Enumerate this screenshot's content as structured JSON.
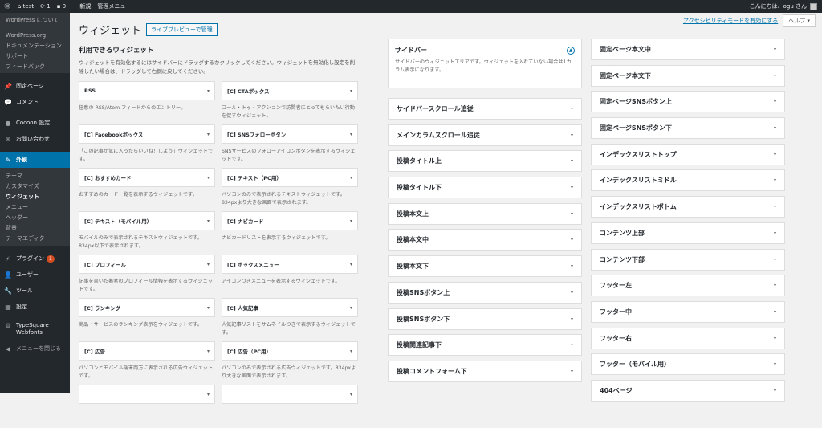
{
  "adminbar": {
    "site": "test",
    "updates": "1",
    "comments": "0",
    "new": "新規",
    "manage": "管理メニュー",
    "greeting": "こんにちは、ogu さん"
  },
  "menu": {
    "about": "WordPress について",
    "org": [
      "WordPress.org",
      "ドキュメンテーション",
      "サポート",
      "フィードバック"
    ],
    "items1": [
      {
        "icon": "📌",
        "label": "固定ページ"
      },
      {
        "icon": "💬",
        "label": "コメント"
      }
    ],
    "items2": [
      {
        "icon": "●",
        "label": "Cocoon 設定"
      },
      {
        "icon": "✉",
        "label": "お問い合わせ"
      }
    ],
    "appearance": "外観",
    "appearance_sub": [
      "テーマ",
      "カスタマイズ",
      "ウィジェット",
      "メニュー",
      "ヘッダー",
      "背景",
      "テーマエディター"
    ],
    "plugins": "プラグイン",
    "plugins_badge": "1",
    "users": "ユーザー",
    "tools": "ツール",
    "settings": "設定",
    "typesquare": "TypeSquare Webfonts",
    "collapse": "メニューを閉じる"
  },
  "screen": {
    "a11y": "アクセシビリティモードを有効にする",
    "help": "ヘルプ ▾"
  },
  "page": {
    "title": "ウィジェット",
    "live_preview": "ライブプレビューで管理"
  },
  "available": {
    "heading": "利用できるウィジェット",
    "desc": "ウィジェットを有効化するにはサイドバーにドラッグするかクリックしてください。ウィジェットを無効化し設定を削除したい場合は、ドラッグして右側に戻してください。",
    "widgets": [
      {
        "name": "RSS",
        "desc": "任意の RSS/Atom フィードからのエントリー。"
      },
      {
        "name": "[C] CTAボックス",
        "desc": "コール・トゥ・アクションで訪問者にとってもらいたい行動を促すウィジェット。"
      },
      {
        "name": "[C] Facebookボックス",
        "desc": "「この記事が気に入ったらいいね！しよう」ウィジェットです。"
      },
      {
        "name": "[C] SNSフォローボタン",
        "desc": "SNSサービスのフォローアイコンボタンを表示するウィジェットです。"
      },
      {
        "name": "[C] おすすめカード",
        "desc": "おすすめのカード一覧を表示するウィジェットです。"
      },
      {
        "name": "[C] テキスト（PC用）",
        "desc": "パソコンのみで表示されるテキストウィジェットです。834pxより大きな画面で表示されます。"
      },
      {
        "name": "[C] テキスト（モバイル用）",
        "desc": "モバイルのみで表示されるテキストウィジェットです。834px以下で表示されます。"
      },
      {
        "name": "[C] ナビカード",
        "desc": "ナビカードリストを表示するウィジェットです。"
      },
      {
        "name": "[C] プロフィール",
        "desc": "記事を書いた著者のプロフィール情報を表示するウィジェットです。"
      },
      {
        "name": "[C] ボックスメニュー",
        "desc": "アイコンつきメニューを表示するウィジェットです。"
      },
      {
        "name": "[C] ランキング",
        "desc": "商品・サービスのランキング表示をウィジェットです。"
      },
      {
        "name": "[C] 人気記事",
        "desc": "人気記事リストをサムネイルつきで表示するウィジェットです。"
      },
      {
        "name": "[C] 広告",
        "desc": "パソコンとモバイル端末両方に表示される広告ウィジェットです。"
      },
      {
        "name": "[C] 広告（PC用）",
        "desc": "パソコンのみで表示される広告ウィジェットです。834pxより大きな画面で表示されます。"
      },
      {
        "name": "",
        "desc": ""
      },
      {
        "name": "",
        "desc": ""
      }
    ]
  },
  "sidebar": {
    "title": "サイドバー",
    "desc": "サイドバーのウィジェットエリアです。ウィジェットを入れていない場合は1カラム表示になります。"
  },
  "areas_col2": [
    "サイドバースクロール追従",
    "メインカラムスクロール追従",
    "投稿タイトル上",
    "投稿タイトル下",
    "投稿本文上",
    "投稿本文中",
    "投稿本文下",
    "投稿SNSボタン上",
    "投稿SNSボタン下",
    "投稿関連記事下",
    "投稿コメントフォーム下"
  ],
  "areas_col3": [
    "固定ページ本文中",
    "固定ページ本文下",
    "固定ページSNSボタン上",
    "固定ページSNSボタン下",
    "インデックスリストトップ",
    "インデックスリストミドル",
    "インデックスリストボトム",
    "コンテンツ上部",
    "コンテンツ下部",
    "フッター左",
    "フッター中",
    "フッター右",
    "フッター（モバイル用）",
    "404ページ"
  ],
  "icons": {
    "arrow": "▾"
  }
}
